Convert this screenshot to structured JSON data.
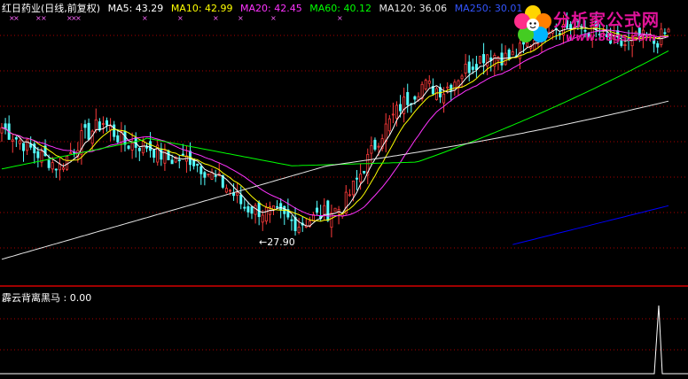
{
  "header": {
    "stock_label": "红日药业(日线,前复权)",
    "ma5": "MA5: 43.29",
    "ma10": "MA10: 42.99",
    "ma20": "MA20: 42.45",
    "ma60": "MA60: 40.12",
    "ma120": "MA120: 36.06",
    "ma250": "MA250: 30.01"
  },
  "indicator": {
    "label": "霹云背离黑马 : 0.00"
  },
  "logo": {
    "brand": "分析家公式网",
    "url": "www.88gs.com"
  },
  "colors": {
    "background": "#000000",
    "up_candle": "#ff3b3b",
    "down_candle": "#54ffff",
    "ma5": "#ffffff",
    "ma10": "#ffff00",
    "ma20": "#ff33ff",
    "ma60": "#00ff00",
    "ma120": "#e6e6e6",
    "ma250": "#0000ff",
    "separator": "#a00000",
    "grid": "#aa0000"
  },
  "chart_data": {
    "type": "candlestick",
    "low_annotation": "←27.90",
    "low_value": 27.9,
    "y_range": [
      26,
      51
    ],
    "indicator_range": [
      0,
      1
    ],
    "indicator_spike_value": 1
  }
}
